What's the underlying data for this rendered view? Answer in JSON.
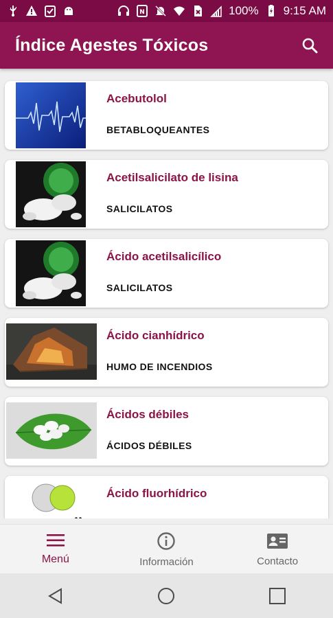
{
  "status_bar": {
    "battery": "100%",
    "time": "9:15 AM",
    "icons_left": [
      "usb-icon",
      "warning-icon",
      "clipboard-check-icon",
      "android-icon"
    ],
    "icons_right": [
      "headset-icon",
      "nfc-icon",
      "mute-icon",
      "wifi-icon",
      "no-sim-icon",
      "signal-icon",
      "battery-icon"
    ]
  },
  "appbar": {
    "title": "Índice Agestes Tóxicos",
    "search_icon": "search-icon"
  },
  "items": [
    {
      "title": "Acebutolol",
      "category": "BETABLOQUEANTES",
      "image": "ecg-thumbnail"
    },
    {
      "title": "Acetilsalicilato de lisina",
      "category": "SALICILATOS",
      "image": "pills-bottle-thumbnail"
    },
    {
      "title": "Ácido acetilsalicílico",
      "category": "SALICILATOS",
      "image": "pills-bottle-thumbnail"
    },
    {
      "title": "Ácido cianhídrico",
      "category": "HUMO DE INCENDIOS",
      "image": "house-fire-thumbnail"
    },
    {
      "title": "Ácidos débiles",
      "category": "ÁCIDOS DÉBILES",
      "image": "pills-on-leaf-thumbnail"
    },
    {
      "title": "Ácido fluorhídrico",
      "category": "",
      "image": "molecule-thumbnail"
    }
  ],
  "bottom_nav": [
    {
      "label": "Menú",
      "icon": "menu-icon",
      "active": true
    },
    {
      "label": "Información",
      "icon": "info-icon",
      "active": false
    },
    {
      "label": "Contacto",
      "icon": "contact-card-icon",
      "active": false
    }
  ],
  "colors": {
    "primary": "#8e1452",
    "status_bar": "#7b0b44",
    "accent_text": "#8b1347"
  }
}
